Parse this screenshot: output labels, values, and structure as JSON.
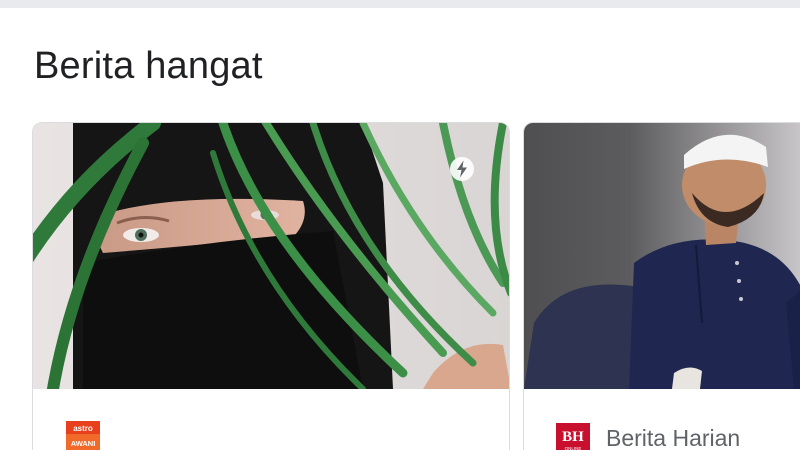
{
  "section": {
    "title": "Berita hangat"
  },
  "cards": [
    {
      "source": {
        "logo_text_top": "astro",
        "logo_text_bottom": "AWANI",
        "name": ""
      },
      "amp_icon": "lightning-bolt-icon"
    },
    {
      "source": {
        "logo_text": "BH",
        "logo_subtext": "ONLINE",
        "name": "Berita Harian"
      }
    }
  ],
  "colors": {
    "title_text": "#202124",
    "source_text": "#5f6368",
    "card_border": "#dadce0",
    "astro_red": "#e8401c",
    "bh_red": "#c8102e"
  }
}
